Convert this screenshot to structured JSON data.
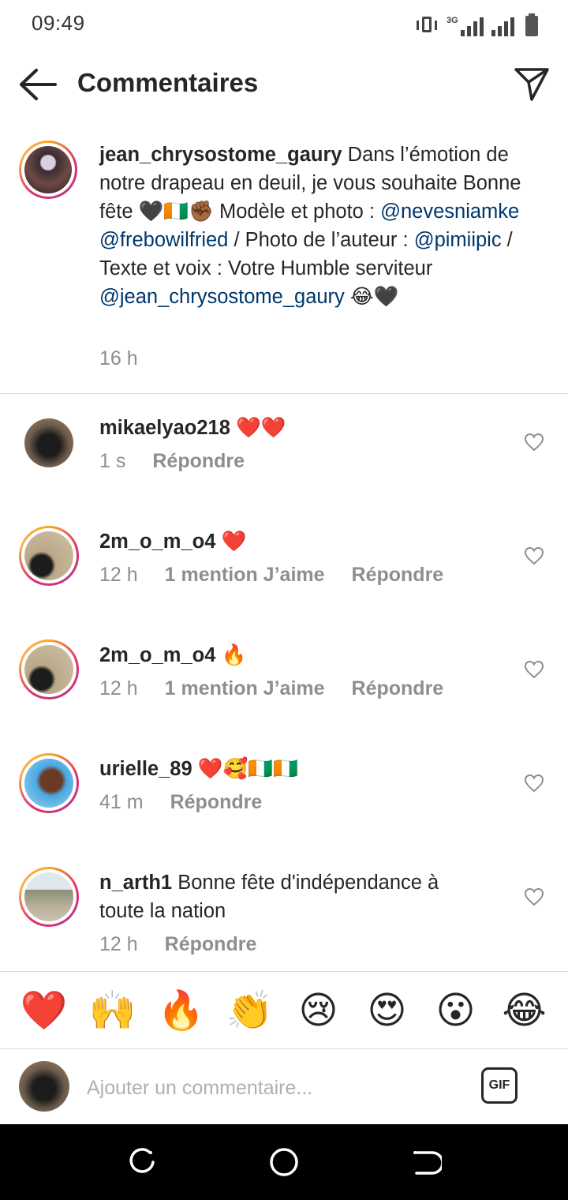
{
  "status_bar": {
    "time": "09:49",
    "network": "3G"
  },
  "header": {
    "title": "Commentaires"
  },
  "caption": {
    "username": "jean_chrysostome_gaury",
    "text_1": " Dans l’émotion de notre drapeau en deuil, je vous souhaite Bonne fête 🖤🇨🇮✊🏾 Modèle et photo : ",
    "mention_1": "@nevesniamke",
    "text_2": " ",
    "mention_2": "@frebowilfried",
    "text_3": " / Photo de l’auteur : ",
    "mention_3": "@pimiipic",
    "text_4": " /  Texte et voix : Votre Humble serviteur ",
    "mention_4": "@jean_chrysostome_gaury",
    "text_5": " 😂🖤",
    "time": "16 h"
  },
  "comments": [
    {
      "username": "mikaelyao218",
      "text": " ❤️❤️",
      "time": "1 s",
      "likes": "",
      "reply": "Répondre"
    },
    {
      "username": "2m_o_m_o4",
      "text": " ❤️",
      "time": "12 h",
      "likes": "1 mention J’aime",
      "reply": "Répondre"
    },
    {
      "username": "2m_o_m_o4",
      "text": " 🔥",
      "time": "12 h",
      "likes": "1 mention J’aime",
      "reply": "Répondre"
    },
    {
      "username": "urielle_89",
      "text": " ❤️🥰🇨🇮🇨🇮",
      "time": "41 m",
      "likes": "",
      "reply": "Répondre"
    },
    {
      "username": "n_arth1",
      "text": " Bonne fête d'indépendance à toute la nation",
      "time": "12 h",
      "likes": "",
      "reply": "Répondre"
    }
  ],
  "emoji_bar": [
    "❤️",
    "🙌",
    "🔥",
    "👏",
    "😢",
    "😍",
    "😮",
    "😂"
  ],
  "input": {
    "placeholder": "Ajouter un commentaire...",
    "gif_label": "GIF"
  },
  "colors": {
    "mention": "#00376b",
    "meta_gray": "#8e8e8e",
    "text": "#262626",
    "divider": "#dbdbdb"
  }
}
